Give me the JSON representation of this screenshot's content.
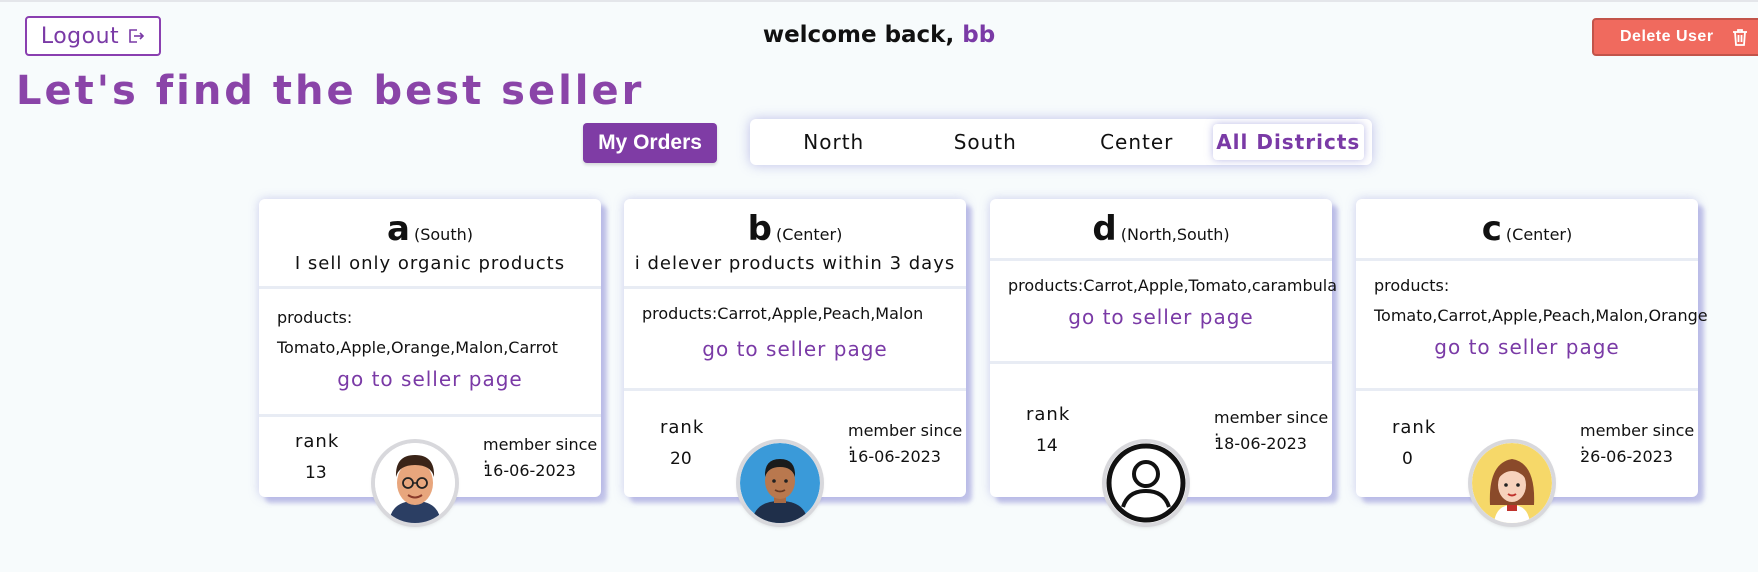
{
  "header": {
    "logout_label": "Logout",
    "welcome_prefix": "welcome back,",
    "username": "bb",
    "delete_label": "Delete User"
  },
  "page_title": "Let's find the best seller",
  "orders_label": "My Orders",
  "districts": [
    "North",
    "South",
    "Center",
    "All Districts"
  ],
  "active_district": "All Districts",
  "sellers": [
    {
      "name": "a",
      "district": "(South)",
      "description": "I sell only organic products",
      "products_label": "products:",
      "products": "Tomato,Apple,Orange,Malon,Carrot",
      "link": "go to seller page",
      "rank_label": "rank",
      "rank": "13",
      "since_label": "member since :",
      "since": "16-06-2023",
      "avatar": "man-glasses-avatar"
    },
    {
      "name": "b",
      "district": "(Center)",
      "description": "i delever products within 3 days",
      "products_label": "products:",
      "products": "Carrot,Apple,Peach,Malon",
      "link": "go to seller page",
      "rank_label": "rank",
      "rank": "20",
      "since_label": "member since :",
      "since": "16-06-2023",
      "avatar": "man-blue-avatar"
    },
    {
      "name": "d",
      "district": "(North,South)",
      "description": "",
      "products_label": "products:",
      "products": "Carrot,Apple,Tomato,carambula",
      "link": "go to seller page",
      "rank_label": "rank",
      "rank": "14",
      "since_label": "member since :",
      "since": "18-06-2023",
      "avatar": "default-user-avatar"
    },
    {
      "name": "c",
      "district": "(Center)",
      "description": "",
      "products_label": "products:",
      "products": "Tomato,Carrot,Apple,Peach,Malon,Orange",
      "link": "go to seller page",
      "rank_label": "rank",
      "rank": "0",
      "since_label": "member since :",
      "since": "26-06-2023",
      "avatar": "woman-avatar"
    }
  ],
  "colors": {
    "accent": "#7a3aa6",
    "delete": "#f06a5e",
    "background": "#f7fbfc"
  }
}
